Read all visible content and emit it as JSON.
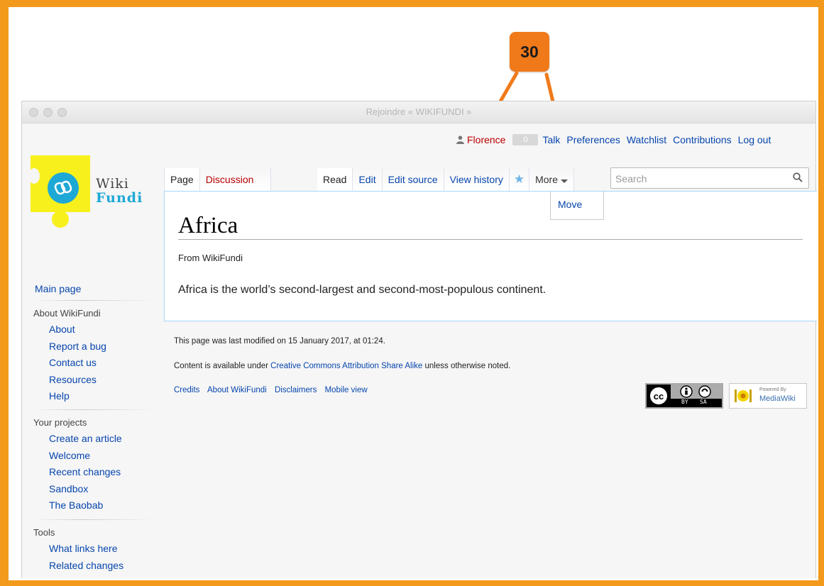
{
  "annotation": {
    "step_number": "30",
    "accent_color": "#f07a1a",
    "frame_color": "#f39a1c"
  },
  "window": {
    "title": "Rejoindre « WIKIFUNDI »"
  },
  "personal_tools": {
    "username": "Florence",
    "notification_count": "0",
    "links": [
      "Talk",
      "Preferences",
      "Watchlist",
      "Contributions",
      "Log out"
    ]
  },
  "logo": {
    "word1": "Wiki",
    "word2": "Fundi",
    "yellow": "#f8f01c",
    "blue": "#1ea8d6"
  },
  "tabs": {
    "namespaces": [
      {
        "label": "Page",
        "selected": true
      },
      {
        "label": "Discussion",
        "selected": false
      }
    ],
    "views": [
      {
        "label": "Read",
        "selected": true
      },
      {
        "label": "Edit",
        "selected": false
      },
      {
        "label": "Edit source",
        "selected": false
      },
      {
        "label": "View history",
        "selected": false
      }
    ],
    "more_label": "More",
    "more_menu": [
      "Move"
    ]
  },
  "search": {
    "placeholder": "Search"
  },
  "article": {
    "title": "Africa",
    "tagline": "From WikiFundi",
    "text": "Africa is the world’s second-largest and second-most-populous continent."
  },
  "sidebar": {
    "main_page": "Main page",
    "portals": [
      {
        "heading": "About WikiFundi",
        "items": [
          "About",
          "Report a bug",
          "Contact us",
          "Resources",
          "Help"
        ]
      },
      {
        "heading": "Your projects",
        "items": [
          "Create an article",
          "Welcome",
          "Recent changes",
          "Sandbox",
          "The Baobab"
        ]
      },
      {
        "heading": "Tools",
        "items": [
          "What links here",
          "Related changes"
        ]
      }
    ]
  },
  "footer": {
    "last_modified": "This page was last modified on 15 January 2017, at 01:24.",
    "license_prefix": "Content is available under ",
    "license_link": "Creative Commons Attribution Share Alike",
    "license_suffix": " unless otherwise noted.",
    "places": [
      "Credits",
      "About WikiFundi",
      "Disclaimers",
      "Mobile view"
    ],
    "cc_by": "BY",
    "cc_sa": "SA",
    "mw_powered": "Powered By",
    "mw_name": "MediaWiki"
  }
}
